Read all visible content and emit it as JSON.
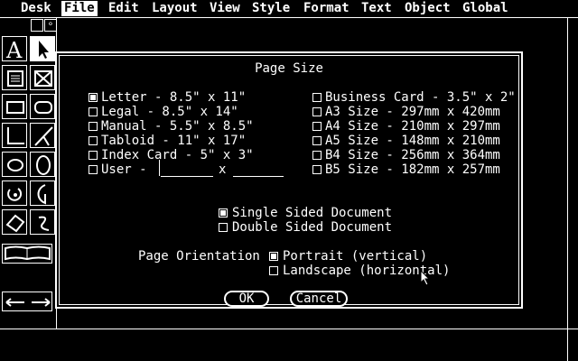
{
  "menubar": {
    "items": [
      "Desk",
      "File",
      "Edit",
      "Layout",
      "View",
      "Style",
      "Format",
      "Text",
      "Object",
      "Global"
    ],
    "active": "File"
  },
  "dialog": {
    "title": "Page Size",
    "sizes_left": [
      {
        "label": "Letter - 8.5\" x 11\"",
        "checked": true
      },
      {
        "label": "Legal - 8.5\" x 14\"",
        "checked": false
      },
      {
        "label": "Manual - 5.5\" x 8.5\"",
        "checked": false
      },
      {
        "label": "Tabloid - 11\" x 17\"",
        "checked": false
      },
      {
        "label": "Index Card - 5\" x 3\"",
        "checked": false
      }
    ],
    "user": {
      "label": "User -",
      "x": "x",
      "width_value": "",
      "height_value": ""
    },
    "sizes_right": [
      {
        "label": "Business Card - 3.5\" x 2\"",
        "checked": false
      },
      {
        "label": "A3 Size - 297mm x 420mm",
        "checked": false
      },
      {
        "label": "A4 Size - 210mm x 297mm",
        "checked": false
      },
      {
        "label": "A5 Size - 148mm x 210mm",
        "checked": false
      },
      {
        "label": "B4 Size - 256mm x 364mm",
        "checked": false
      },
      {
        "label": "B5 Size - 182mm x 257mm",
        "checked": false
      }
    ],
    "sides": [
      {
        "label": "Single Sided Document",
        "checked": true
      },
      {
        "label": "Double Sided Document",
        "checked": false
      }
    ],
    "orientation_label": "Page Orientation",
    "orientation": [
      {
        "label": "Portrait (vertical)",
        "checked": true
      },
      {
        "label": "Landscape (horizontal)",
        "checked": false
      }
    ],
    "ok_label": "OK",
    "cancel_label": "Cancel"
  }
}
